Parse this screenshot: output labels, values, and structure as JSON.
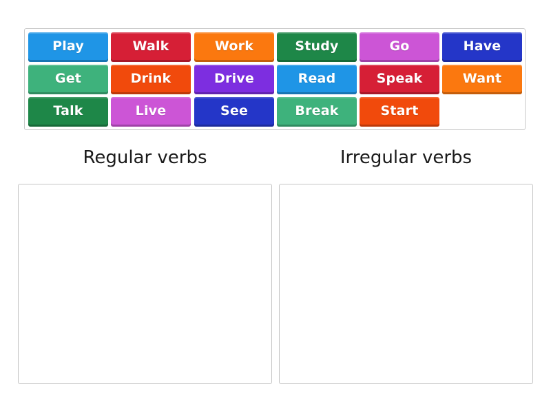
{
  "tiles": [
    {
      "label": "Play",
      "color": "#1f95e6"
    },
    {
      "label": "Walk",
      "color": "#d61f36"
    },
    {
      "label": "Work",
      "color": "#fb780f"
    },
    {
      "label": "Study",
      "color": "#1e8748"
    },
    {
      "label": "Go",
      "color": "#cc55d6"
    },
    {
      "label": "Have",
      "color": "#2436c8"
    },
    {
      "label": "Get",
      "color": "#3eb27c"
    },
    {
      "label": "Drink",
      "color": "#f14a0c"
    },
    {
      "label": "Drive",
      "color": "#7d2ee0"
    },
    {
      "label": "Read",
      "color": "#1f95e6"
    },
    {
      "label": "Speak",
      "color": "#d61f36"
    },
    {
      "label": "Want",
      "color": "#fb780f"
    },
    {
      "label": "Talk",
      "color": "#1e8748"
    },
    {
      "label": "Live",
      "color": "#cc55d6"
    },
    {
      "label": "See",
      "color": "#2436c8"
    },
    {
      "label": "Break",
      "color": "#3eb27c"
    },
    {
      "label": "Start",
      "color": "#f14a0c"
    }
  ],
  "groups": [
    {
      "title": "Regular verbs"
    },
    {
      "title": "Irregular verbs"
    }
  ]
}
